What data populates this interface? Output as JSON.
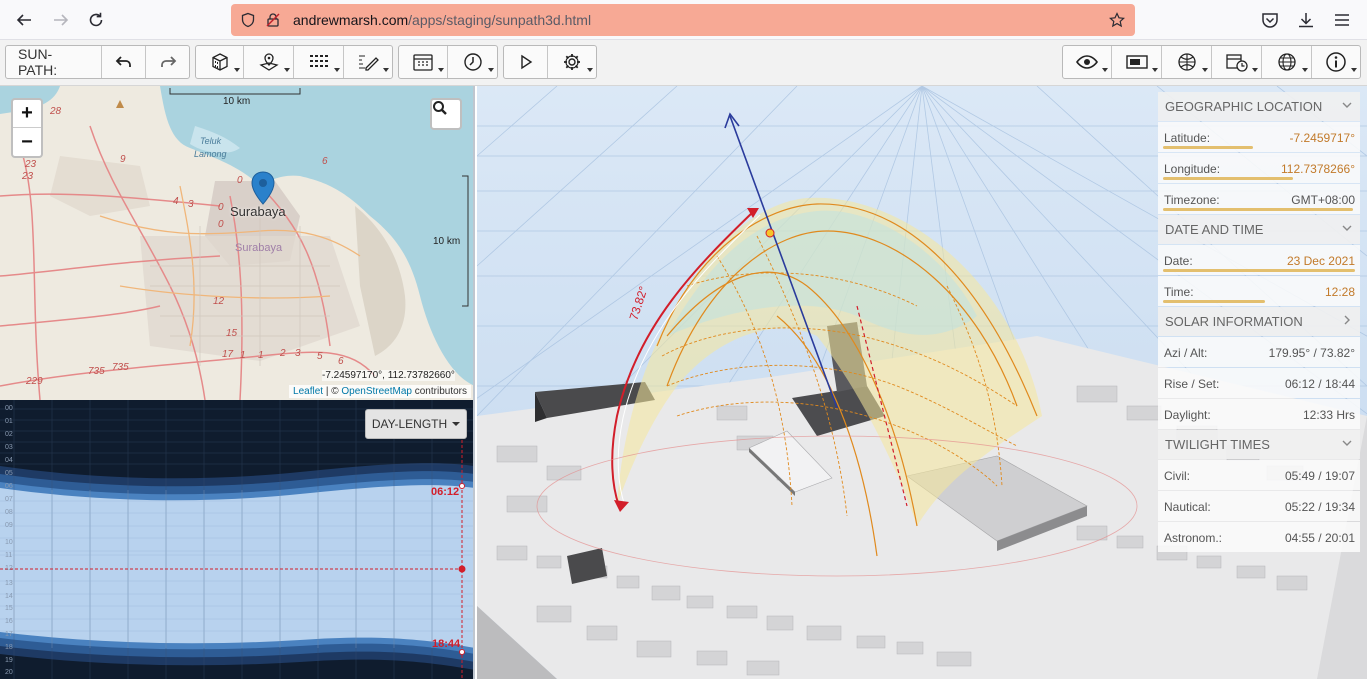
{
  "browser": {
    "url_host": "andrewmarsh.com",
    "url_path": "/apps/staging/sunpath3d.html"
  },
  "toolbar": {
    "app_label": "SUN-PATH:"
  },
  "map": {
    "scale_top": "10 km",
    "scale_right": "10 km",
    "city": "Surabaya",
    "city_faded": "Surabaya",
    "bay_label_1": "Teluk",
    "bay_label_2": "Lamong",
    "coordinates": "-7.24597170°, 112.73782660°",
    "attribution_leaflet": "Leaflet",
    "attribution_sep": " | © ",
    "attribution_osm": "OpenStreetMap",
    "attribution_tail": " contributors",
    "road_numbers": [
      "28",
      "23",
      "23",
      "9",
      "4",
      "3",
      "0",
      "0",
      "6",
      "0",
      "12",
      "15",
      "17",
      "1",
      "1",
      "2",
      "3",
      "5",
      "6",
      "229",
      "735",
      "735",
      "12"
    ]
  },
  "daylength": {
    "mode_label": "DAY-LENGTH",
    "sunrise": "06:12",
    "sunset": "18:44",
    "hours": [
      "00",
      "01",
      "02",
      "03",
      "04",
      "05",
      "06",
      "07",
      "08",
      "09",
      "10",
      "11",
      "12",
      "13",
      "14",
      "15",
      "16",
      "17",
      "18",
      "19",
      "20"
    ]
  },
  "scene": {
    "altitude_label": "73.82°"
  },
  "info": {
    "geo": {
      "title": "GEOGRAPHIC LOCATION",
      "latitude_label": "Latitude:",
      "latitude": "-7.2459717°",
      "longitude_label": "Longitude:",
      "longitude": "112.7378266°",
      "timezone_label": "Timezone:",
      "timezone": "GMT+08:00"
    },
    "datetime": {
      "title": "DATE AND TIME",
      "date_label": "Date:",
      "date": "23 Dec 2021",
      "time_label": "Time:",
      "time": "12:28"
    },
    "solar": {
      "title": "SOLAR INFORMATION",
      "azi_label": "Azi / Alt:",
      "azi": "179.95° / 73.82°",
      "rise_label": "Rise / Set:",
      "rise": "06:12 / 18:44",
      "daylight_label": "Daylight:",
      "daylight": "12:33 Hrs"
    },
    "twilight": {
      "title": "TWILIGHT TIMES",
      "civil_label": "Civil:",
      "civil": "05:49 / 19:07",
      "nautical_label": "Nautical:",
      "nautical": "05:22 / 19:34",
      "astro_label": "Astronom.:",
      "astro": "04:55 / 20:01"
    }
  },
  "colors": {
    "urlbar": "#f7a995",
    "sunpath": "#e08a1e",
    "sunpath_fill": "#f5e79a",
    "arc": "#d21e2a",
    "axis": "#2a3b9c",
    "grid": "#a8c2e0"
  }
}
